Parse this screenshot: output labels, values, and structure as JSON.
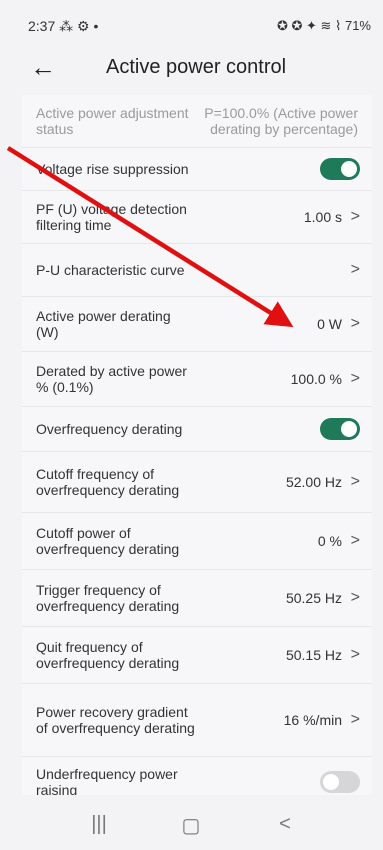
{
  "status_bar": {
    "time": "2:37",
    "left_icons": "⁂ ⚙ •",
    "right_icons": "✪ ✪ ✦ ≋ ⌇",
    "battery": "71%"
  },
  "header": {
    "back": "←",
    "title": "Active power control"
  },
  "rows": [
    {
      "label": "Active power adjustment status",
      "value": "P=100.0% (Active power derating by percentage)"
    },
    {
      "label": "Voltage rise suppression",
      "toggle": true
    },
    {
      "label": "PF (U) voltage detection filtering time",
      "value": "1.00 s"
    },
    {
      "label": "P-U characteristic curve",
      "value": ""
    },
    {
      "label": "Active power derating (W)",
      "value": "0 W"
    },
    {
      "label": "Derated by active power % (0.1%)",
      "value": "100.0 %"
    },
    {
      "label": "Overfrequency derating",
      "toggle": true
    },
    {
      "label": "Cutoff frequency of overfrequency derating",
      "value": "52.00 Hz"
    },
    {
      "label": "Cutoff power of overfrequency derating",
      "value": "0 %"
    },
    {
      "label": "Trigger frequency of overfrequency derating",
      "value": "50.25 Hz"
    },
    {
      "label": "Quit frequency of overfrequency derating",
      "value": "50.15 Hz"
    },
    {
      "label": "Power recovery gradient of overfrequency derating",
      "value": "16 %/min"
    },
    {
      "label": "Underfrequency power raising",
      "toggle": false
    }
  ],
  "chevron": ">",
  "nav": {
    "recent": "|||",
    "home": "▢",
    "back": "<"
  },
  "colors": {
    "toggle_on": "#1f7a5a",
    "toggle_off": "#d6d6d8",
    "annotation_arrow": "#e01010"
  }
}
